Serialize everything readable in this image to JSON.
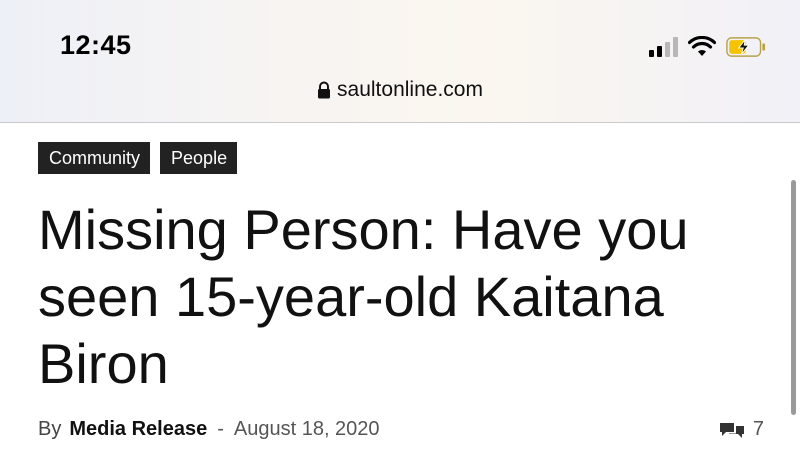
{
  "status_bar": {
    "time": "12:45",
    "battery_color": "#f5c400"
  },
  "browser": {
    "url": "saultonline.com"
  },
  "article": {
    "tags": [
      "Community",
      "People"
    ],
    "headline": "Missing Person: Have you seen 15-year-old Kaitana Biron",
    "byline_prefix": "By",
    "author": "Media Release",
    "separator": "-",
    "date": "August 18, 2020",
    "comment_count": "7"
  }
}
